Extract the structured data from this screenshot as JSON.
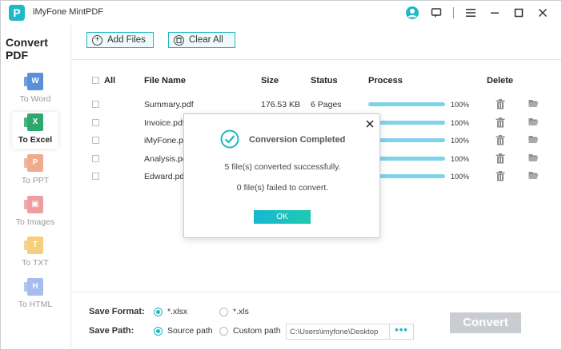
{
  "window": {
    "title": "iMyFone MintPDF",
    "logo_letter": "P"
  },
  "titlebar_icons": [
    "user-icon",
    "feedback-icon",
    "menu-icon",
    "minimize-icon",
    "maximize-icon",
    "close-icon"
  ],
  "sidebar": {
    "title": "Convert PDF",
    "items": [
      {
        "label": "To Word",
        "glyph": "W",
        "color": "#5b8fd9",
        "active": false
      },
      {
        "label": "To Excel",
        "glyph": "X",
        "color": "#2ea86b",
        "active": true
      },
      {
        "label": "To PPT",
        "glyph": "P",
        "color": "#f0ab8e",
        "active": false
      },
      {
        "label": "To Images",
        "glyph": "▣",
        "color": "#ef9e9e",
        "active": false
      },
      {
        "label": "To TXT",
        "glyph": "T",
        "color": "#f3cf7e",
        "active": false
      },
      {
        "label": "To HTML",
        "glyph": "H",
        "color": "#a7bcee",
        "active": false
      }
    ]
  },
  "toolbar": {
    "add_files_label": "Add Files",
    "clear_all_label": "Clear All"
  },
  "table": {
    "headers": {
      "all": "All",
      "file_name": "File Name",
      "size": "Size",
      "status": "Status",
      "process": "Process",
      "delete": "Delete"
    },
    "rows": [
      {
        "file_name": "Summary.pdf",
        "size": "176.53 KB",
        "status": "6 Pages",
        "progress": 100,
        "progress_label": "100%"
      },
      {
        "file_name": "Invoice.pdf",
        "size": "",
        "status": "",
        "progress": 100,
        "progress_label": "100%"
      },
      {
        "file_name": "iMyFone.pd",
        "size": "",
        "status": "",
        "progress": 100,
        "progress_label": "100%"
      },
      {
        "file_name": "Analysis.pdf",
        "size": "",
        "status": "",
        "progress": 100,
        "progress_label": "100%"
      },
      {
        "file_name": "Edward.pdf",
        "size": "",
        "status": "",
        "progress": 100,
        "progress_label": "100%"
      }
    ]
  },
  "bottom": {
    "save_format_label": "Save Format:",
    "format_options": [
      {
        "label": "*.xlsx",
        "selected": true
      },
      {
        "label": "*.xls",
        "selected": false
      }
    ],
    "save_path_label": "Save Path:",
    "path_options": [
      {
        "label": "Source path",
        "selected": true
      },
      {
        "label": "Custom path",
        "selected": false
      }
    ],
    "path_value": "C:\\Users\\imyfone\\Desktop",
    "browse_label": "•••",
    "convert_label": "Convert"
  },
  "dialog": {
    "title": "Conversion Completed",
    "success_message": "5 file(s) converted successfully.",
    "fail_message": "0 file(s) failed to convert.",
    "ok_label": "OK"
  },
  "colors": {
    "accent": "#1fb8c4",
    "progress_fill": "#7ed3e8",
    "convert_disabled": "#c9cdd1"
  }
}
